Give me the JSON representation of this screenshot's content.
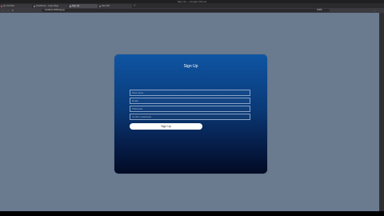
{
  "window": {
    "title": "Sign Up — Google Chrome"
  },
  "tabs": [
    {
      "label": "(1) YouTube"
    },
    {
      "label": "JavaScript – Login Page"
    },
    {
      "label": "Sign Up"
    },
    {
      "label": "New Tab"
    }
  ],
  "navbar": {
    "url": "localhost:3000/signup",
    "zoom": "100%"
  },
  "form": {
    "title": "Sign Up",
    "fields": [
      {
        "placeholder": "First name"
      },
      {
        "placeholder": "Email"
      },
      {
        "placeholder": "Password"
      },
      {
        "placeholder": "Confirm password"
      }
    ],
    "submit_label": "Sign Up"
  },
  "colors": {
    "page_background": "#6a7a8f",
    "card_top": "#0f55a3",
    "card_bottom": "#020b24",
    "button": "#ffffff"
  },
  "icons": {
    "back": "back-arrow-icon",
    "forward": "forward-arrow-icon",
    "reload": "reload-icon",
    "menu": "kebab-menu-icon"
  }
}
